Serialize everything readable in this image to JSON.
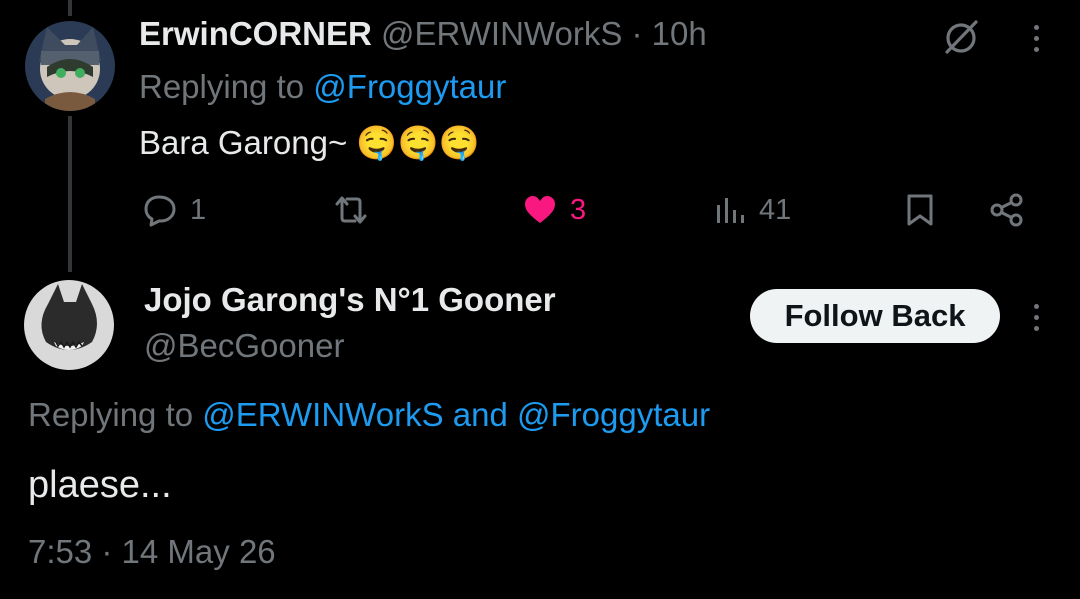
{
  "tweet1": {
    "display_name": "ErwinCORNER",
    "handle": "@ERWINWorkS",
    "separator": "·",
    "time": "10h",
    "replying_label": "Replying to",
    "replying_to": "@Froggytaur",
    "text": "Bara Garong~ 🤤🤤🤤",
    "actions": {
      "replies": "1",
      "likes": "3",
      "views": "41"
    },
    "icons": [
      "grok-icon",
      "more-icon",
      "reply-icon",
      "retweet-icon",
      "heart-icon",
      "views-icon",
      "bookmark-icon",
      "share-icon"
    ]
  },
  "tweet2": {
    "display_name": "Jojo Garong's N°1 Gooner",
    "handle": "@BecGooner",
    "follow_label": "Follow Back",
    "replying_label": "Replying to",
    "replying_to_1": "@ERWINWorkS",
    "replying_and": "and",
    "replying_to_2": "@Froggytaur",
    "text": "plaese...",
    "timestamp": "7:53 · 14 May 26"
  },
  "colors": {
    "background": "#000000",
    "text": "#e7e9ea",
    "muted": "#71767b",
    "link": "#1d9bf0",
    "like": "#f91880",
    "button_bg": "#eff3f4"
  }
}
